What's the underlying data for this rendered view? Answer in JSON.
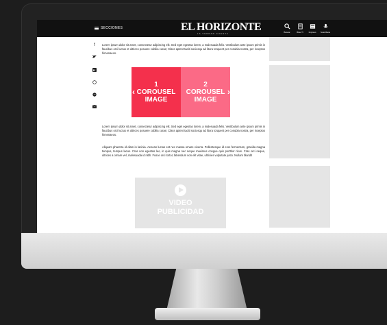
{
  "header": {
    "menu_label": "SECCIONES",
    "logo": "EL HORIZONTE",
    "slogan": "LA VERDAD CUENTA",
    "tools": [
      {
        "label": "Buscar",
        "icon": "search-icon"
      },
      {
        "label": "Blau.TI",
        "icon": "document-icon"
      },
      {
        "label": "Impreso",
        "icon": "newspaper-icon"
      },
      {
        "label": "Suscribete",
        "icon": "podcast-icon"
      }
    ]
  },
  "social_icons": [
    "facebook-icon",
    "twitter-icon",
    "linkedin-icon",
    "whatsapp-icon",
    "messenger-icon",
    "email-icon"
  ],
  "article": {
    "paragraph1": "Lorem ipsum dolor sit amet, consectetur adipiscing elit. Sed eget egestas lorem, a malesuada felis. Vestibulum ante ipsum primis in faucibus orci luctus et ultrices posuere cubilia curae; Class aptent taciti sociosqu ad litora torquent per conubia nostra, per inceptos himenaeos.",
    "paragraph2": "Lorem ipsum dolor sit amet, consectetur adipiscing elit. Sed eget egestas lorem, a malesuada felis. Vestibulum ante ipsum primis in faucibus orci luctus et ultrices posuere cubilia curae; Class aptent taciti sociosqu ad litora torquent per conubia nostra, per inceptos himenaeos.",
    "paragraph3": "Aliquam pharetra id diam in lacinia. Aenean luctus est nec massa ornare viverra. Pellentesque id eros fermentum, gravida magna tempus, tempus lacus. Cras non egestas leo, in quis magna nec neque maximus congue quis porttitor risus. Cras orci neque, ultrices a ornare vel, malesuada id nibh. Fusce orci tortor, bibendum non elit vitae, ultricies vulputate justo. Nullam blandit"
  },
  "carousel": {
    "slides": [
      {
        "number": "1",
        "line1": "COROUSEL",
        "line2": "IMAGE"
      },
      {
        "number": "2",
        "line1": "COROUSEL",
        "line2": "IMAGE"
      }
    ],
    "prev_arrow": "‹",
    "next_arrow": "›"
  },
  "video": {
    "line1": "VIDEO",
    "line2": "PUBLICIDAD"
  },
  "colors": {
    "slide1": "#f4304c",
    "slide2": "#fb6a86",
    "placeholder": "#e5e5e5",
    "header": "#111111"
  }
}
